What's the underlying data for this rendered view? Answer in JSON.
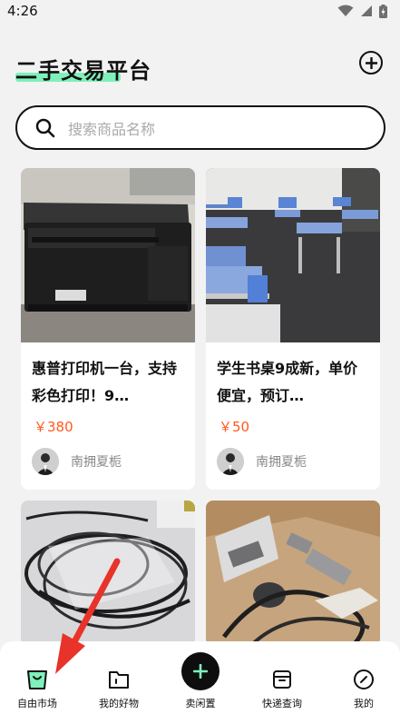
{
  "status_bar": {
    "time": "4:26"
  },
  "header": {
    "title": "二手交易平台"
  },
  "search": {
    "placeholder": "搜索商品名称"
  },
  "products": [
    {
      "title": "惠普打印机一台，支持彩色打印！9…",
      "price": "￥380",
      "seller": "南拥夏栀",
      "image": "black-printer-photo"
    },
    {
      "title": "学生书桌9成新，单价便宜，预订…",
      "price": "￥50",
      "seller": "南拥夏栀",
      "image": "classroom-desks-photo"
    },
    {
      "title": "",
      "price": "",
      "seller": "",
      "image": "cables-in-plastic-bag-photo"
    },
    {
      "title": "",
      "price": "",
      "seller": "",
      "image": "hair-clipper-kit-in-box-photo"
    }
  ],
  "tab_bar": {
    "items": [
      {
        "label": "自由市场",
        "icon": "bag-icon"
      },
      {
        "label": "我的好物",
        "icon": "folder-icon"
      },
      {
        "label": "卖闲置",
        "icon": "plus-icon"
      },
      {
        "label": "快递查询",
        "icon": "box-icon"
      },
      {
        "label": "我的",
        "icon": "profile-icon"
      }
    ],
    "active_index": 0
  },
  "colors": {
    "accent_green": "#7ff0b9",
    "price_orange": "#ff5a1f",
    "annotation_red": "#e8332a"
  }
}
